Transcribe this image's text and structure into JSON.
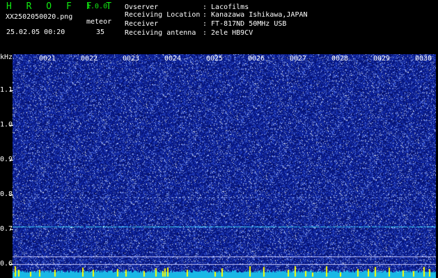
{
  "header": {
    "app_title": "H R O F F T",
    "app_version": "1.0.0",
    "file_name": "XX2502050020.png",
    "meteor_label": "meteor",
    "timestamp": "25.02.05 00:20",
    "meteor_count": "35",
    "meta": [
      {
        "label": "Ovserver",
        "value": ": Lacofilms"
      },
      {
        "label": "Receiving Location",
        "value": ": Kanazawa Ishikawa,JAPAN"
      },
      {
        "label": "Receiver",
        "value": ": FT-817ND 50MHz USB"
      },
      {
        "label": "Receiving antenna",
        "value": ": 2ele HB9CV"
      }
    ]
  },
  "spectrogram": {
    "y_unit": "kHz",
    "y_ticks": [
      "1.1",
      "1.0",
      "0.9",
      "0.8",
      "0.7",
      "0.6"
    ],
    "x_ticks": [
      "0021",
      "0022",
      "0023",
      "0024",
      "0025",
      "0026",
      "0027",
      "0028",
      "0029",
      "0030"
    ],
    "colors": {
      "background": "#0a1f9a",
      "noise": "#ffffff",
      "signal": "#3fd6ff",
      "bottom_bar": "#19b8e6",
      "spikes": "#ffff00"
    }
  }
}
